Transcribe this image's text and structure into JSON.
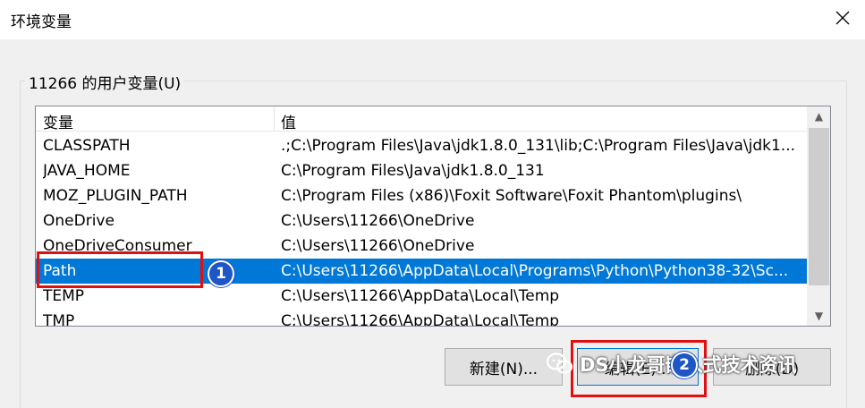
{
  "window": {
    "title": "环境变量"
  },
  "user_vars": {
    "group_label": "11266 的用户变量(U)",
    "headers": {
      "name": "变量",
      "value": "值"
    },
    "rows": [
      {
        "name": "CLASSPATH",
        "value": ".;C:\\Program Files\\Java\\jdk1.8.0_131\\lib;C:\\Program Files\\Java\\jdk1..."
      },
      {
        "name": "JAVA_HOME",
        "value": "C:\\Program Files\\Java\\jdk1.8.0_131"
      },
      {
        "name": "MOZ_PLUGIN_PATH",
        "value": "C:\\Program Files (x86)\\Foxit Software\\Foxit Phantom\\plugins\\"
      },
      {
        "name": "OneDrive",
        "value": "C:\\Users\\11266\\OneDrive"
      },
      {
        "name": "OneDriveConsumer",
        "value": "C:\\Users\\11266\\OneDrive"
      },
      {
        "name": "Path",
        "value": "C:\\Users\\11266\\AppData\\Local\\Programs\\Python\\Python38-32\\Sc...",
        "selected": true
      },
      {
        "name": "TEMP",
        "value": "C:\\Users\\11266\\AppData\\Local\\Temp"
      },
      {
        "name": "TMP",
        "value": "C:\\Users\\11266\\AppData\\Local\\Temp"
      }
    ]
  },
  "buttons": {
    "new": "新建(N)...",
    "edit": "编辑(E)...",
    "delete": "删除(D)"
  },
  "annotations": {
    "badge1": "1",
    "badge2": "2"
  },
  "watermark": {
    "text": "DS小龙哥嵌入式技术资讯"
  },
  "colors": {
    "selection": "#0078d7",
    "highlight": "#e01010",
    "badge": "#1e56c8"
  }
}
